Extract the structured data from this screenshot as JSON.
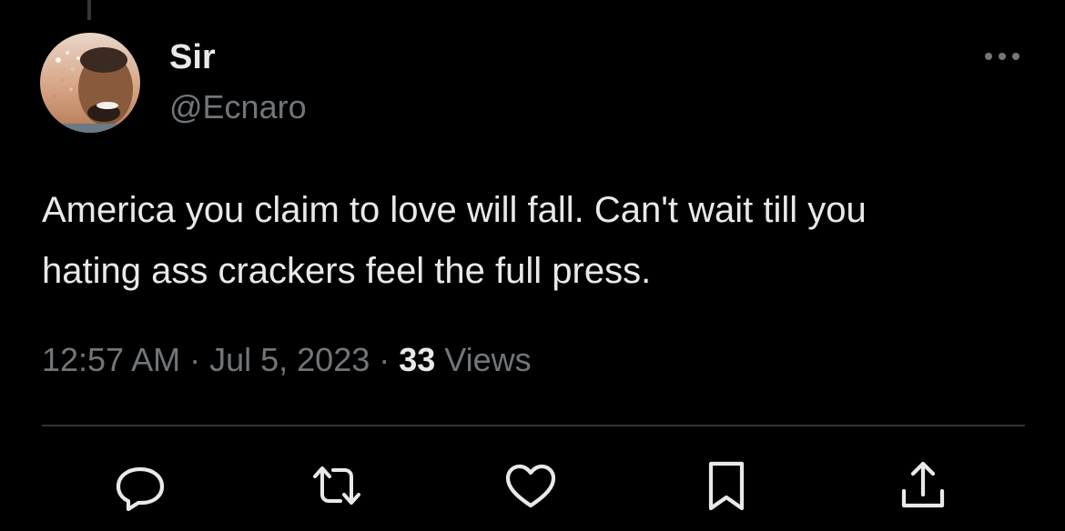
{
  "tweet": {
    "author": {
      "display_name": "Sir",
      "handle": "@Ecnaro"
    },
    "text": "America you claim to love will fall. Can't wait till you\nhating ass crackers feel the full press.",
    "timestamp": "12:57 AM",
    "separator": " · ",
    "date": "Jul 5, 2023",
    "views_count": "33",
    "views_label": " Views"
  },
  "actions": [
    {
      "name": "reply",
      "icon": "reply-icon"
    },
    {
      "name": "retweet",
      "icon": "retweet-icon"
    },
    {
      "name": "like",
      "icon": "heart-icon"
    },
    {
      "name": "bookmark",
      "icon": "bookmark-icon"
    },
    {
      "name": "share",
      "icon": "share-icon"
    }
  ],
  "more_icon": "more-horizontal-icon",
  "colors": {
    "background": "#000000",
    "primary_text": "#e7e9ea",
    "secondary_text": "#71767b",
    "divider": "#2f3336",
    "icon": "#e7e9ea"
  }
}
